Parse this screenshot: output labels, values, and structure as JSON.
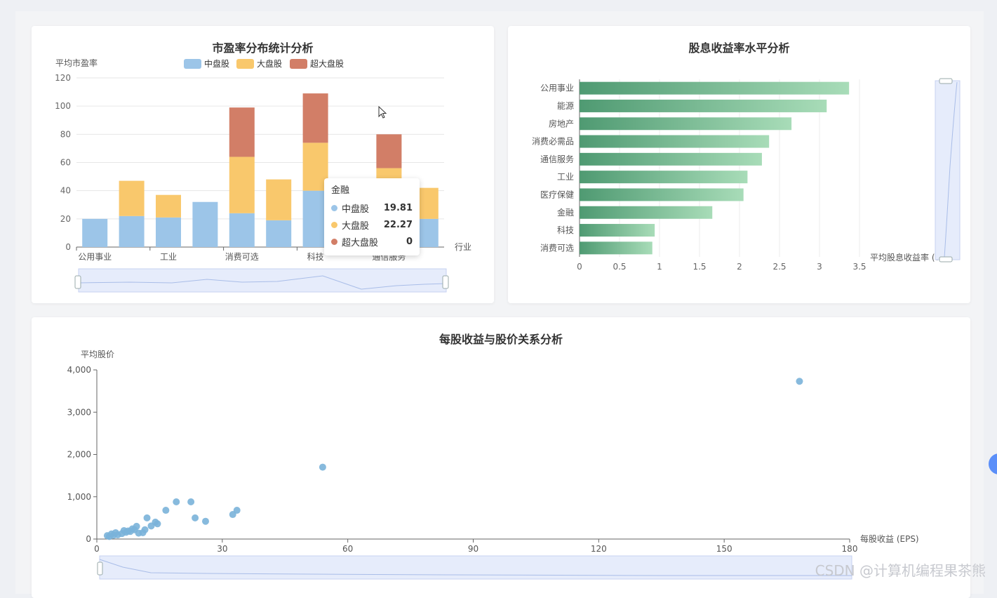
{
  "pe_chart": {
    "title": "市盈率分布统计分析",
    "ylabel": "平均市盈率",
    "xlabel": "行业",
    "legend": [
      "中盘股",
      "大盘股",
      "超大盘股"
    ],
    "colors": {
      "mid": "#9cc5e8",
      "large": "#f9c86c",
      "xl": "#d27e67"
    },
    "tooltip": {
      "title": "金融",
      "rows": [
        {
          "name": "中盘股",
          "value": "19.81"
        },
        {
          "name": "大盘股",
          "value": "22.27"
        },
        {
          "name": "超大盘股",
          "value": "0"
        }
      ]
    }
  },
  "div_chart": {
    "title": "股息收益率水平分析",
    "xlabel": "平均股息收益率 (%)"
  },
  "eps_chart": {
    "title": "每股收益与股价关系分析",
    "ylabel": "平均股价",
    "xlabel": "每股收益 (EPS)"
  },
  "chart_data": [
    {
      "type": "bar",
      "title": "市盈率分布统计分析",
      "xlabel": "行业",
      "ylabel": "平均市盈率",
      "ylim": [
        0,
        120
      ],
      "yticks": [
        "0",
        "20",
        "40",
        "60",
        "80",
        "100",
        "120"
      ],
      "categories": [
        "公用事业",
        "",
        "工业",
        "",
        "消费可选",
        "",
        "科技",
        "",
        "通信服务",
        ""
      ],
      "category_labels_shown": [
        "公用事业",
        "工业",
        "消费可选",
        "科技",
        "通信服务"
      ],
      "series": [
        {
          "name": "中盘股",
          "values": [
            20,
            22,
            21,
            32,
            24,
            19,
            40,
            0,
            0,
            20
          ]
        },
        {
          "name": "大盘股",
          "values": [
            0,
            25,
            16,
            0,
            40,
            29,
            34,
            0,
            0,
            22
          ]
        },
        {
          "name": "超大盘股",
          "values": [
            0,
            0,
            0,
            0,
            35,
            0,
            35,
            0,
            0,
            0
          ]
        }
      ],
      "partial_bar": {
        "category_index": 8,
        "mid": 0,
        "large": 56,
        "xl": 24
      },
      "legend_position": "top"
    },
    {
      "type": "bar",
      "orientation": "horizontal",
      "title": "股息收益率水平分析",
      "xlabel": "平均股息收益率 (%)",
      "xlim": [
        0,
        3.5
      ],
      "xticks": [
        "0",
        "0.5",
        "1",
        "1.5",
        "2",
        "2.5",
        "3",
        "3.5"
      ],
      "categories": [
        "公用事业",
        "能源",
        "房地产",
        "消费必需品",
        "通信服务",
        "工业",
        "医疗保健",
        "金融",
        "科技",
        "消费可选"
      ],
      "values": [
        3.37,
        3.09,
        2.65,
        2.37,
        2.28,
        2.1,
        2.05,
        1.66,
        0.94,
        0.91
      ]
    },
    {
      "type": "scatter",
      "title": "每股收益与股价关系分析",
      "xlabel": "每股收益 (EPS)",
      "ylabel": "平均股价",
      "xlim": [
        0,
        180
      ],
      "ylim": [
        0,
        4000
      ],
      "xticks": [
        "0",
        "30",
        "60",
        "90",
        "120",
        "150",
        "180"
      ],
      "yticks": [
        "0",
        "1,000",
        "2,000",
        "3,000",
        "4,000"
      ],
      "points": [
        [
          2.5,
          80
        ],
        [
          3,
          60
        ],
        [
          3.5,
          120
        ],
        [
          4,
          90
        ],
        [
          4.5,
          150
        ],
        [
          5,
          100
        ],
        [
          6,
          130
        ],
        [
          6.5,
          200
        ],
        [
          7,
          160
        ],
        [
          7.5,
          190
        ],
        [
          8,
          180
        ],
        [
          8.5,
          240
        ],
        [
          9,
          220
        ],
        [
          9.5,
          300
        ],
        [
          10,
          140
        ],
        [
          11,
          150
        ],
        [
          11.5,
          220
        ],
        [
          12,
          500
        ],
        [
          13,
          310
        ],
        [
          14,
          400
        ],
        [
          14.5,
          360
        ],
        [
          16.5,
          680
        ],
        [
          19,
          880
        ],
        [
          22.5,
          880
        ],
        [
          23.5,
          500
        ],
        [
          26,
          420
        ],
        [
          32.5,
          580
        ],
        [
          33.5,
          680
        ],
        [
          54,
          1700
        ],
        [
          168,
          3730
        ]
      ]
    }
  ],
  "watermark": "CSDN @计算机编程果茶熊"
}
